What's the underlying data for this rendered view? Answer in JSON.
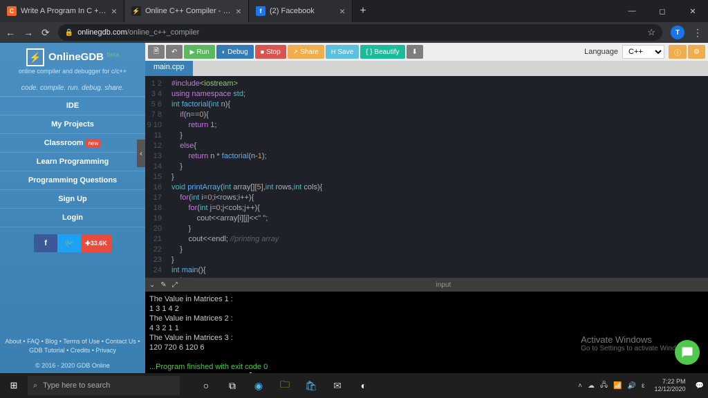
{
  "browser": {
    "tabs": [
      {
        "title": "Write A Program In C ++ Langu",
        "icon": "C",
        "iconBg": "#f26522"
      },
      {
        "title": "Online C++ Compiler - online ed",
        "icon": "⚡",
        "iconBg": "#222"
      },
      {
        "title": "(2) Facebook",
        "icon": "f",
        "iconBg": "#1877f2"
      }
    ],
    "url_host": "onlinegdb.com",
    "url_path": "/online_c++_compiler"
  },
  "sidebar": {
    "brand": "OnlineGDB",
    "beta": "beta",
    "tagline": "online compiler and debugger for c/c++",
    "slogan": "code. compile. run. debug. share.",
    "items": [
      "IDE",
      "My Projects",
      "Classroom",
      "Learn Programming",
      "Programming Questions",
      "Sign Up",
      "Login"
    ],
    "new_label": "new",
    "share_count": "33.6K",
    "footer1": "About • FAQ • Blog • Terms of Use • Contact Us • GDB Tutorial • Credits • Privacy",
    "footer2": "© 2016 - 2020 GDB Online"
  },
  "toolbar": {
    "run": "Run",
    "debug": "Debug",
    "stop": "Stop",
    "share": "Share",
    "save": "Save",
    "beautify": "{ } Beautify",
    "lang_label": "Language",
    "lang_value": "C++"
  },
  "editor": {
    "tab": "main.cpp",
    "lines": 24
  },
  "console": {
    "label": "input",
    "l1": "The Value in Matrices 1 :",
    "l2": "1 3 1 4 2 ",
    "l3": "The Value in Matrices 2 :",
    "l4": "4 3 2 1 1 ",
    "l5": "The Value in Matrices 3 :",
    "l6": "120 720 6 120 6 ",
    "exit": "...Program finished with exit code 0",
    "prompt": "Press ENTER to exit console."
  },
  "windows": {
    "activate": "Activate Windows",
    "activate_sub": "Go to Settings to activate Windows.",
    "search_placeholder": "Type here to search",
    "time": "7:22 PM",
    "date": "12/12/2020"
  }
}
